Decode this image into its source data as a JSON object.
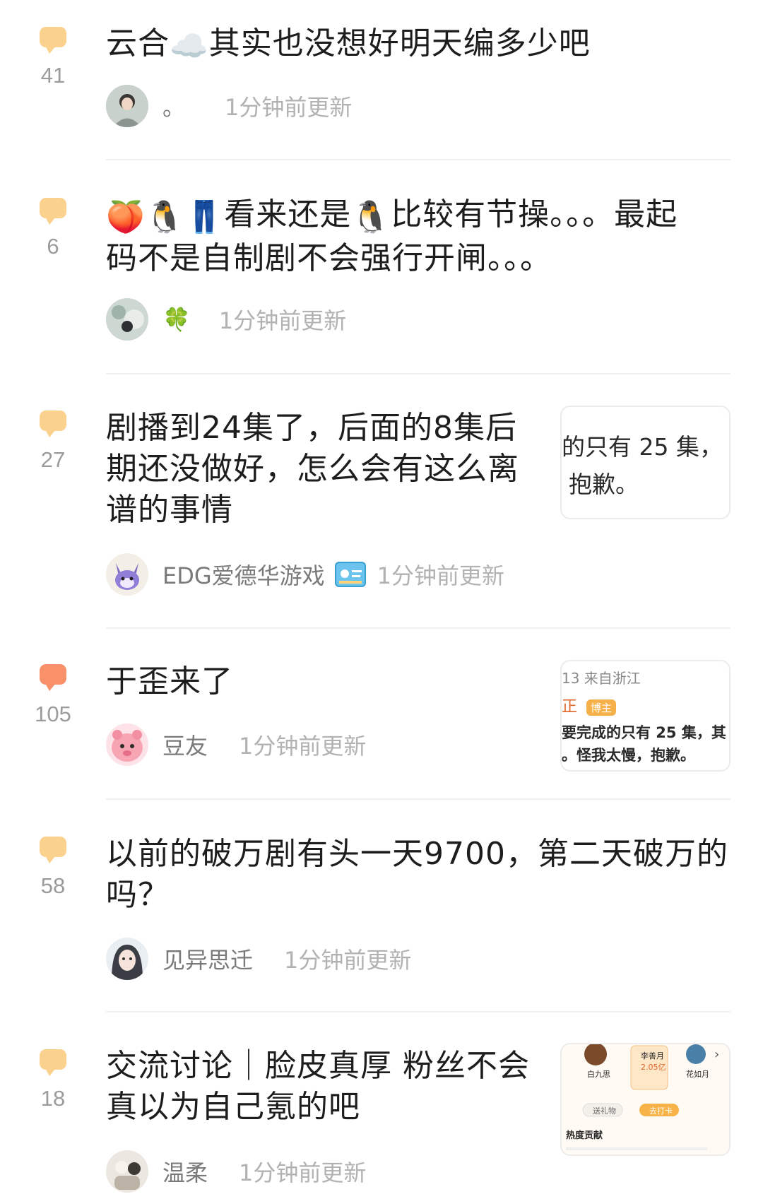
{
  "posts": [
    {
      "count": "41",
      "title_before": "云合",
      "title_emoji": "☁️",
      "title_after": "其实也没想好明天编多少吧",
      "author": "。",
      "time": "1分钟前更新"
    },
    {
      "count": "6",
      "title_emojis": [
        "🍑",
        "🐧",
        "👖"
      ],
      "title_part1": "看来还是",
      "title_emoji_mid": "🐧",
      "title_part2": "比较有节操。。。最起",
      "title_line2": "码不是自制剧不会强行开闸。。。",
      "author": "🍀",
      "time": "1分钟前更新"
    },
    {
      "count": "27",
      "title_line1": "剧播到24集了，后面的8集后",
      "title_line2": "期还没做好，怎么会有这么离",
      "title_line3": "谱的事情",
      "author": "EDG爱德华游戏",
      "time": "1分钟前更新",
      "thumb_line1": "的只有 25 集，",
      "thumb_line2": "抱歉。"
    },
    {
      "count": "105",
      "title": "于歪来了",
      "author": "豆友",
      "time": "1分钟前更新",
      "thumb_line1": "13 来自浙江",
      "thumb_line2": "正",
      "thumb_badge": "博主",
      "thumb_line3": "要完成的只有 25 集，其",
      "thumb_line4": "。怪我太慢，抱歉。"
    },
    {
      "count": "58",
      "title_line1": "以前的破万剧有头一天9700，第二天破万的",
      "title_line2": "吗？",
      "author": "见异思迁",
      "time": "1分钟前更新"
    },
    {
      "count": "18",
      "title_line1": "交流讨论｜脸皮真厚 粉丝不会",
      "title_line2": "真以为自己氪的吧",
      "author": "温柔",
      "time": "1分钟前更新",
      "thumb_names": [
        "白九思",
        "李善月",
        "花如月"
      ],
      "thumb_value": "2.05亿",
      "thumb_btn1": "送礼物",
      "thumb_btn2": "去打卡",
      "thumb_section": "热度贡献"
    }
  ],
  "colors": {
    "bubble_normal": "#fbd28d",
    "bubble_hot": "#f8906a",
    "title_text": "#1d1d1d",
    "meta_text": "#b2b2b2"
  },
  "icons": {
    "comment": "comment-bubble-icon",
    "id_badge": "id-card-icon",
    "author_suffix": "clover"
  }
}
